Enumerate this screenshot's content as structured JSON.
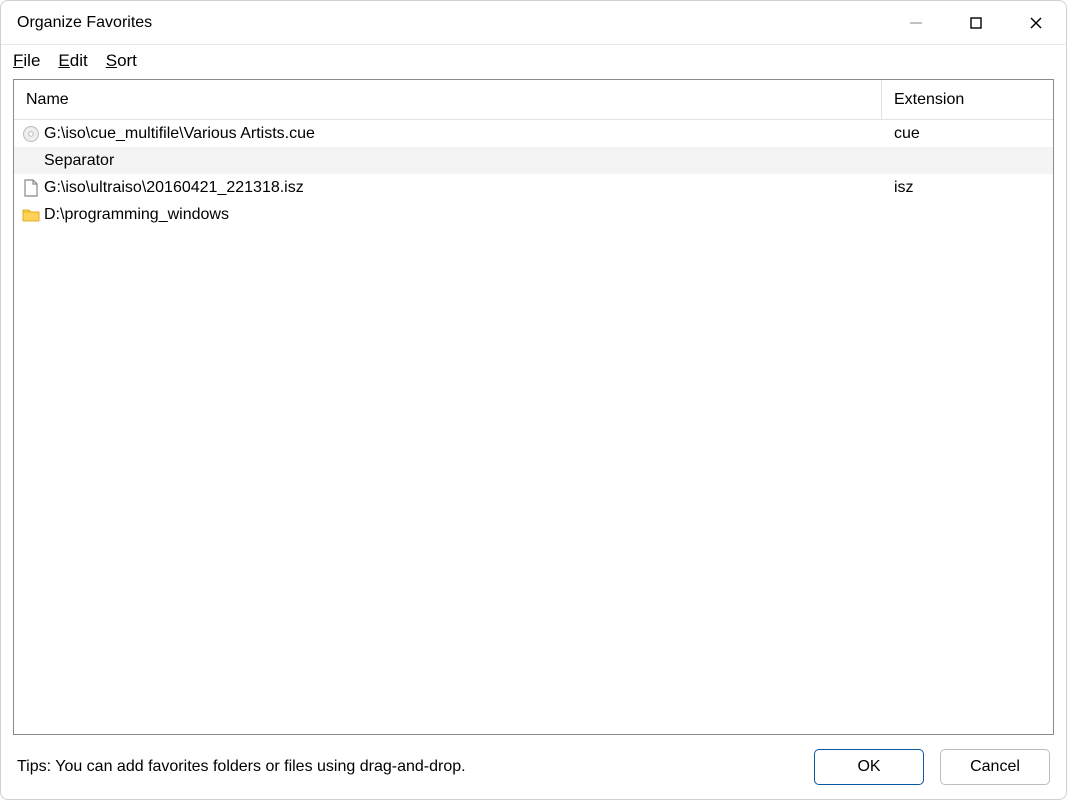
{
  "window": {
    "title": "Organize Favorites"
  },
  "menu": {
    "items": [
      {
        "accel": "F",
        "rest": "ile"
      },
      {
        "accel": "E",
        "rest": "dit"
      },
      {
        "accel": "S",
        "rest": "ort"
      }
    ]
  },
  "columns": {
    "name": "Name",
    "extension": "Extension"
  },
  "rows": [
    {
      "icon": "disc",
      "name": "G:\\iso\\cue_multifile\\Various Artists.cue",
      "ext": "cue",
      "highlight": false,
      "indent": false
    },
    {
      "icon": "",
      "name": "Separator",
      "ext": "",
      "highlight": true,
      "indent": true
    },
    {
      "icon": "file",
      "name": "G:\\iso\\ultraiso\\20160421_221318.isz",
      "ext": "isz",
      "highlight": false,
      "indent": false
    },
    {
      "icon": "folder",
      "name": "D:\\programming_windows",
      "ext": "",
      "highlight": false,
      "indent": false
    }
  ],
  "footer": {
    "tips": "Tips: You can add favorites folders or files using drag-and-drop.",
    "ok": "OK",
    "cancel": "Cancel"
  }
}
